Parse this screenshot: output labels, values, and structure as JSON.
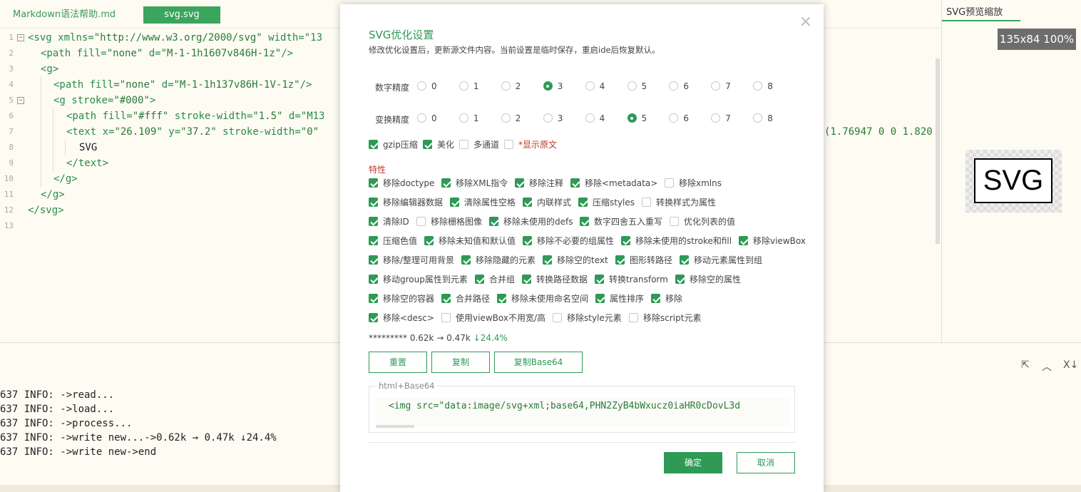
{
  "tabs": [
    {
      "label": "Markdown语法帮助.md"
    },
    {
      "label": "svg.svg"
    }
  ],
  "editor": {
    "lines": [
      {
        "num": "1",
        "parts": [
          [
            "tg",
            "<svg "
          ],
          [
            "at",
            "xmlns="
          ],
          [
            "st",
            "\"http://www.w3.org/2000/svg\""
          ],
          [
            "at",
            " width=\"13"
          ]
        ]
      },
      {
        "num": "2",
        "parts": [
          [
            "tg",
            "<path "
          ],
          [
            "at",
            "fill="
          ],
          [
            "st",
            "\"none\""
          ],
          [
            "at",
            " d="
          ],
          [
            "st",
            "\"M-1-1h1607v846H-1z\""
          ],
          [
            "tg",
            "/>"
          ]
        ]
      },
      {
        "num": "3",
        "parts": [
          [
            "tg",
            "<g>"
          ]
        ]
      },
      {
        "num": "4",
        "parts": [
          [
            "tg",
            "<path "
          ],
          [
            "at",
            "fill="
          ],
          [
            "st",
            "\"none\""
          ],
          [
            "at",
            " d="
          ],
          [
            "st",
            "\"M-1-1h137v86H-1V-1z\""
          ],
          [
            "tg",
            "/>"
          ]
        ]
      },
      {
        "num": "5",
        "parts": [
          [
            "tg",
            "<g "
          ],
          [
            "at",
            "stroke="
          ],
          [
            "st",
            "\"#000\""
          ],
          [
            "tg",
            ">"
          ]
        ]
      },
      {
        "num": "6",
        "parts": [
          [
            "tg",
            "<path "
          ],
          [
            "at",
            "fill="
          ],
          [
            "st",
            "\"#fff\""
          ],
          [
            "at",
            " stroke-width="
          ],
          [
            "st",
            "\"1.5\""
          ],
          [
            "at",
            " d=\"M13"
          ]
        ]
      },
      {
        "num": "7",
        "parts": [
          [
            "tg",
            "<text "
          ],
          [
            "at",
            "x="
          ],
          [
            "st",
            "\"26.109\""
          ],
          [
            "at",
            " y="
          ],
          [
            "st",
            "\"37.2\""
          ],
          [
            "at",
            " stroke-width="
          ],
          [
            "st",
            "\"0\""
          ]
        ]
      },
      {
        "num": "8",
        "parts": [
          [
            "",
            "SVG"
          ]
        ]
      },
      {
        "num": "9",
        "parts": [
          [
            "tg",
            "</text>"
          ]
        ]
      },
      {
        "num": "10",
        "parts": [
          [
            "tg",
            "</g>"
          ]
        ]
      },
      {
        "num": "11",
        "parts": [
          [
            "tg",
            "</g>"
          ]
        ]
      },
      {
        "num": "12",
        "parts": [
          [
            "tg",
            "</svg>"
          ]
        ]
      },
      {
        "num": "13",
        "parts": []
      }
    ],
    "overflow_text": "(1.76947 0 0 1.820"
  },
  "right_panel": {
    "title": "SVG预览缩放",
    "zoom_badge": "135x84 100%",
    "preview_text": "SVG"
  },
  "console": {
    "lines": [
      "637 INFO: ->read...",
      "637 INFO: ->load...",
      "637 INFO: ->process...",
      "637 INFO: ->write new...->0.62k → 0.47k ↓24.4%",
      "637 INFO: ->write new->end"
    ],
    "icons": [
      "export-icon",
      "chevron-up-icon",
      "close-icon"
    ]
  },
  "dialog": {
    "title": "SVG优化设置",
    "subtitle": "修改优化设置后，更新源文件内容。当前设置是临时保存，重启ide后恢复默认。",
    "close_glyph": "×",
    "precision_rows": [
      {
        "label": "数字精度",
        "options": [
          "0",
          "1",
          "2",
          "3",
          "4",
          "5",
          "6",
          "7",
          "8"
        ],
        "selected": "3"
      },
      {
        "label": "变换精度",
        "options": [
          "0",
          "1",
          "2",
          "3",
          "4",
          "5",
          "6",
          "7",
          "8"
        ],
        "selected": "5"
      }
    ],
    "options_row": [
      {
        "label": "gzip压缩",
        "checked": true,
        "red": false
      },
      {
        "label": "美化",
        "checked": true,
        "red": false
      },
      {
        "label": "多通道",
        "checked": false,
        "red": false
      },
      {
        "label": "*显示原文",
        "checked": false,
        "red": true
      }
    ],
    "features_title": "特性",
    "features": [
      [
        {
          "label": "移除doctype",
          "checked": true
        },
        {
          "label": "移除XML指令",
          "checked": true
        },
        {
          "label": "移除注释",
          "checked": true
        },
        {
          "label": "移除<metadata>",
          "checked": true
        },
        {
          "label": "移除xmlns",
          "checked": false
        }
      ],
      [
        {
          "label": "移除编辑器数据",
          "checked": true
        },
        {
          "label": "清除属性空格",
          "checked": true
        },
        {
          "label": "内联样式",
          "checked": true
        },
        {
          "label": "压缩styles",
          "checked": true
        },
        {
          "label": "转换样式为属性",
          "checked": false
        }
      ],
      [
        {
          "label": "清除ID",
          "checked": true
        },
        {
          "label": "移除栅格图像",
          "checked": false
        },
        {
          "label": "移除未使用的defs",
          "checked": true
        },
        {
          "label": "数字四舍五入重写",
          "checked": true
        },
        {
          "label": "优化列表的值",
          "checked": false
        }
      ],
      [
        {
          "label": "压缩色值",
          "checked": true
        },
        {
          "label": "移除未知值和默认值",
          "checked": true
        },
        {
          "label": "移除不必要的组属性",
          "checked": true
        },
        {
          "label": "移除未使用的stroke和fill",
          "checked": true
        },
        {
          "label": "移除viewBox",
          "checked": true
        }
      ],
      [
        {
          "label": "移除/整理可用背景",
          "checked": true
        },
        {
          "label": "移除隐藏的元素",
          "checked": true
        },
        {
          "label": "移除空的text",
          "checked": true
        },
        {
          "label": "图形转路径",
          "checked": true
        },
        {
          "label": "移动元素属性到组",
          "checked": true
        }
      ],
      [
        {
          "label": "移动group属性到元素",
          "checked": true
        },
        {
          "label": "合并组",
          "checked": true
        },
        {
          "label": "转换路径数据",
          "checked": true
        },
        {
          "label": "转换transform",
          "checked": true
        },
        {
          "label": "移除空的属性",
          "checked": true
        }
      ],
      [
        {
          "label": "移除空的容器",
          "checked": true
        },
        {
          "label": "合并路径",
          "checked": true
        },
        {
          "label": "移除未使用命名空间",
          "checked": true
        },
        {
          "label": "属性排序",
          "checked": true
        },
        {
          "label": "移除",
          "checked": true
        }
      ],
      [
        {
          "label": "移除<desc>",
          "checked": true
        },
        {
          "label": "使用viewBox不用宽/高",
          "checked": false
        },
        {
          "label": "移除style元素",
          "checked": false
        },
        {
          "label": "移除script元素",
          "checked": false
        }
      ]
    ],
    "size_info": {
      "prefix": "********* 0.62k → 0.47k ",
      "percent": "↓24.4%"
    },
    "buttons": {
      "reset": "重置",
      "copy": "复制",
      "copy_base64": "复制Base64"
    },
    "base64": {
      "legend": "html+Base64",
      "code": "<img src=\"data:image/svg+xml;base64,PHN2ZyB4bWxucz0iaHR0cDovL3d"
    },
    "ok": "确定",
    "cancel": "取消"
  },
  "colors": {
    "accent": "#2e9a55",
    "red": "#c0392b",
    "background": "#fdfbf2"
  }
}
